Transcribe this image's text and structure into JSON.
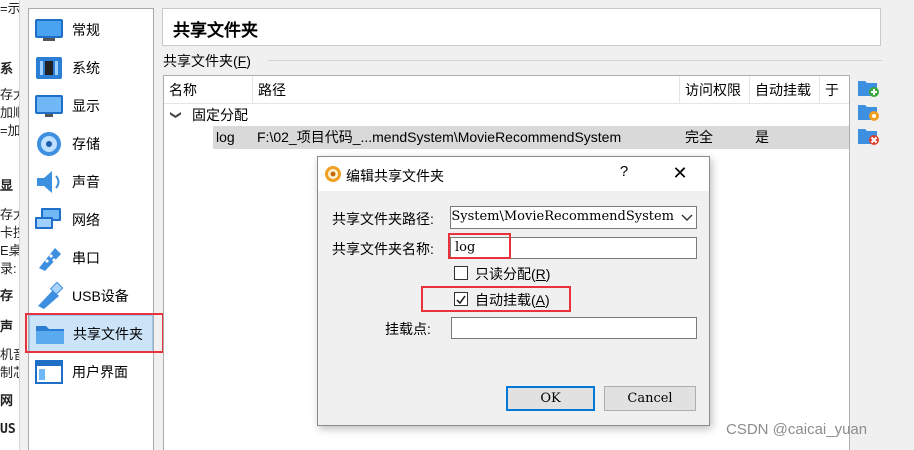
{
  "left_fragments": [
    {
      "text": "=示"
    },
    {
      "text": "显"
    },
    {
      "text": "系"
    },
    {
      "text": "存大"
    },
    {
      "text": "加顺"
    },
    {
      "text": "=加"
    },
    {
      "text": "显"
    },
    {
      "text": "存大"
    },
    {
      "text": "卡控"
    },
    {
      "text": "E桌"
    },
    {
      "text": "录:"
    },
    {
      "text": "存"
    },
    {
      "text": "声"
    },
    {
      "text": "机音"
    },
    {
      "text": "制芯"
    },
    {
      "text": "网"
    },
    {
      "text": "US"
    }
  ],
  "sidebar": {
    "items": [
      {
        "label": "常规",
        "icon": "general-icon"
      },
      {
        "label": "系统",
        "icon": "system-icon"
      },
      {
        "label": "显示",
        "icon": "display-icon"
      },
      {
        "label": "存储",
        "icon": "storage-icon"
      },
      {
        "label": "声音",
        "icon": "audio-icon"
      },
      {
        "label": "网络",
        "icon": "network-icon"
      },
      {
        "label": "串口",
        "icon": "serial-port-icon"
      },
      {
        "label": "USB设备",
        "icon": "usb-icon"
      },
      {
        "label": "共享文件夹",
        "icon": "shared-folder-icon"
      },
      {
        "label": "用户界面",
        "icon": "user-interface-icon"
      }
    ],
    "selected_index": 8
  },
  "page": {
    "title": "共享文件夹",
    "section_label": "共享文件夹(",
    "section_mnemonic": "F",
    "section_label_end": ")"
  },
  "table": {
    "columns": [
      "名称",
      "路径",
      "访问权限",
      "自动挂载",
      "于"
    ],
    "group": {
      "label": "固定分配",
      "expander": "❯"
    },
    "rows": [
      {
        "name": "log",
        "path": "F:\\02_项目代码_...mendSystem\\MovieRecommendSystem",
        "access": "完全",
        "automount": "是"
      }
    ]
  },
  "tools": [
    {
      "icon": "add-shared-folder-icon"
    },
    {
      "icon": "edit-shared-folder-icon"
    },
    {
      "icon": "remove-shared-folder-icon"
    }
  ],
  "dialog": {
    "title": "编辑共享文件夹",
    "help": "?",
    "close": "✕",
    "path_label": "共享文件夹路径:",
    "path_value": "dSystem\\MovieRecommendSystem",
    "name_label": "共享文件夹名称:",
    "name_value": "log",
    "readonly_label": "只读分配(",
    "readonly_mnemonic": "R",
    "readonly_label_end": ")",
    "readonly_checked": false,
    "automount_label": "自动挂载(",
    "automount_mnemonic": "A",
    "automount_label_end": ")",
    "automount_checked": true,
    "mountpoint_label": "挂载点:",
    "mountpoint_value": "",
    "ok": "OK",
    "cancel": "Cancel"
  },
  "watermark": "CSDN @caicai_yuan",
  "colors": {
    "selection": "#cce4f7",
    "highlight_red": "#e8323c",
    "row_selected": "#d9d9d9",
    "accent": "#0078d7"
  }
}
